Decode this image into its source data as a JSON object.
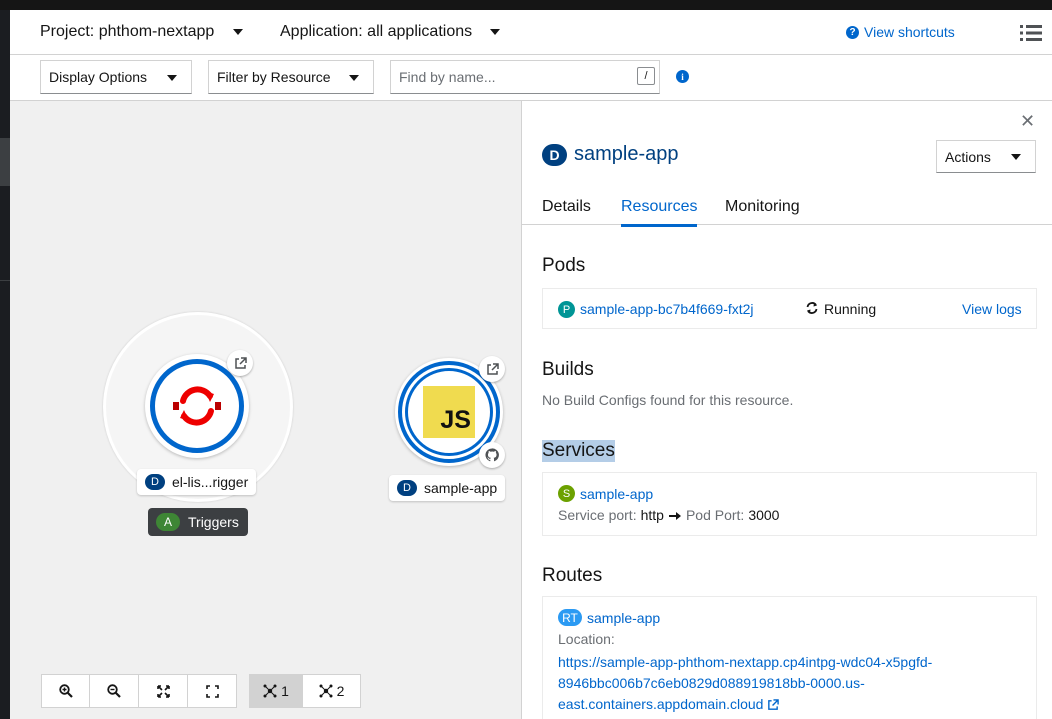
{
  "header": {
    "project_label": "Project: phthom-nextapp",
    "application_label": "Application: all applications",
    "shortcuts_label": "View shortcuts"
  },
  "toolbar": {
    "display_options": "Display Options",
    "filter_by_resource": "Filter by Resource",
    "search_placeholder": "Find by name...",
    "search_key": "/"
  },
  "topology": {
    "group_node": {
      "badge": "D",
      "label": "el-lis...rigger"
    },
    "triggers": {
      "badge": "A",
      "label": "Triggers"
    },
    "app_node": {
      "badge": "D",
      "label": "sample-app",
      "logo": "JS"
    },
    "controls": [
      {
        "icon": "zoom-in-icon"
      },
      {
        "icon": "zoom-out-icon"
      },
      {
        "icon": "fit-to-screen-icon"
      },
      {
        "icon": "expand-icon"
      }
    ],
    "layouts": [
      {
        "icon": "topology-layout-icon",
        "label": "1",
        "active": true
      },
      {
        "icon": "topology-layout-icon",
        "label": "2",
        "active": false
      }
    ]
  },
  "panel": {
    "resource_badge": "D",
    "resource_name": "sample-app",
    "actions_label": "Actions",
    "tabs": [
      {
        "label": "Details",
        "active": false
      },
      {
        "label": "Resources",
        "active": true
      },
      {
        "label": "Monitoring",
        "active": false
      }
    ],
    "pods": {
      "heading": "Pods",
      "badge": "P",
      "name": "sample-app-bc7b4f669-fxt2j",
      "status": "Running",
      "view_logs": "View logs"
    },
    "builds": {
      "heading": "Builds",
      "empty_text": "No Build Configs found for this resource."
    },
    "services": {
      "heading": "Services",
      "badge": "S",
      "name": "sample-app",
      "service_port_label": "Service port:",
      "service_port_value": "http",
      "pod_port_label": "Pod Port:",
      "pod_port_value": "3000"
    },
    "routes": {
      "heading": "Routes",
      "badge": "RT",
      "name": "sample-app",
      "location_label": "Location:",
      "url_line1": "https://sample-app-phthom-nextapp.cp4intpg-wdc04-x5pgfd-",
      "url_line2": "8946bbc006b7c6eb0829d088919818bb-0000.us-",
      "url_line3": "east.containers.appdomain.cloud"
    }
  },
  "colors": {
    "link": "#0066cc",
    "deployment_badge": "#004080",
    "node_ring": "#0066cc",
    "pipeline_red": "#e00"
  }
}
